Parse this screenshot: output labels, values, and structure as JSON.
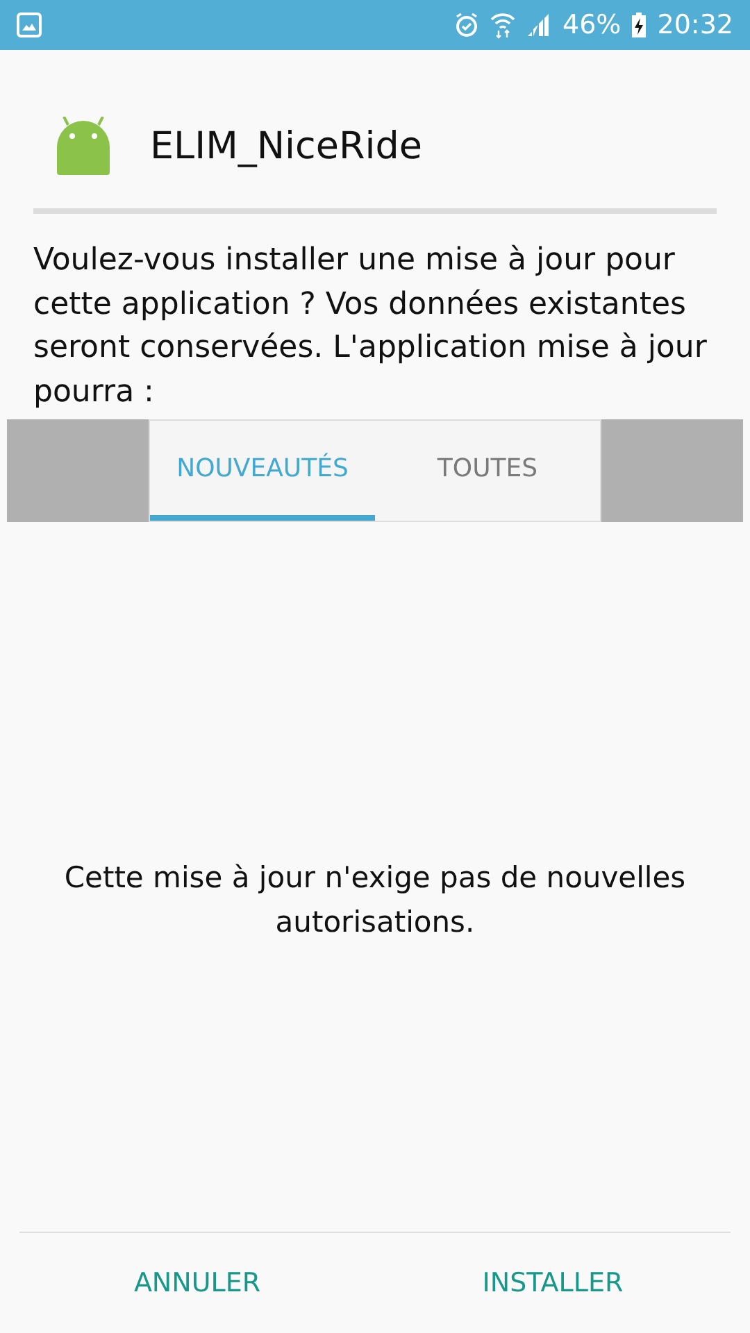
{
  "status_bar": {
    "battery": "46%",
    "time": "20:32"
  },
  "app": {
    "name": "ELIM_NiceRide"
  },
  "message": "Voulez-vous installer une mise à jour pour cette application ? Vos données existantes seront conservées. L'application mise à jour pourra :",
  "tabs": [
    {
      "label": "NOUVEAUTÉS",
      "selected": true
    },
    {
      "label": "TOUTES",
      "selected": false
    }
  ],
  "notice": "Cette mise à jour n'exige pas de nouvelles autorisations.",
  "buttons": [
    {
      "label": "ANNULER"
    },
    {
      "label": "INSTALLER"
    }
  ]
}
